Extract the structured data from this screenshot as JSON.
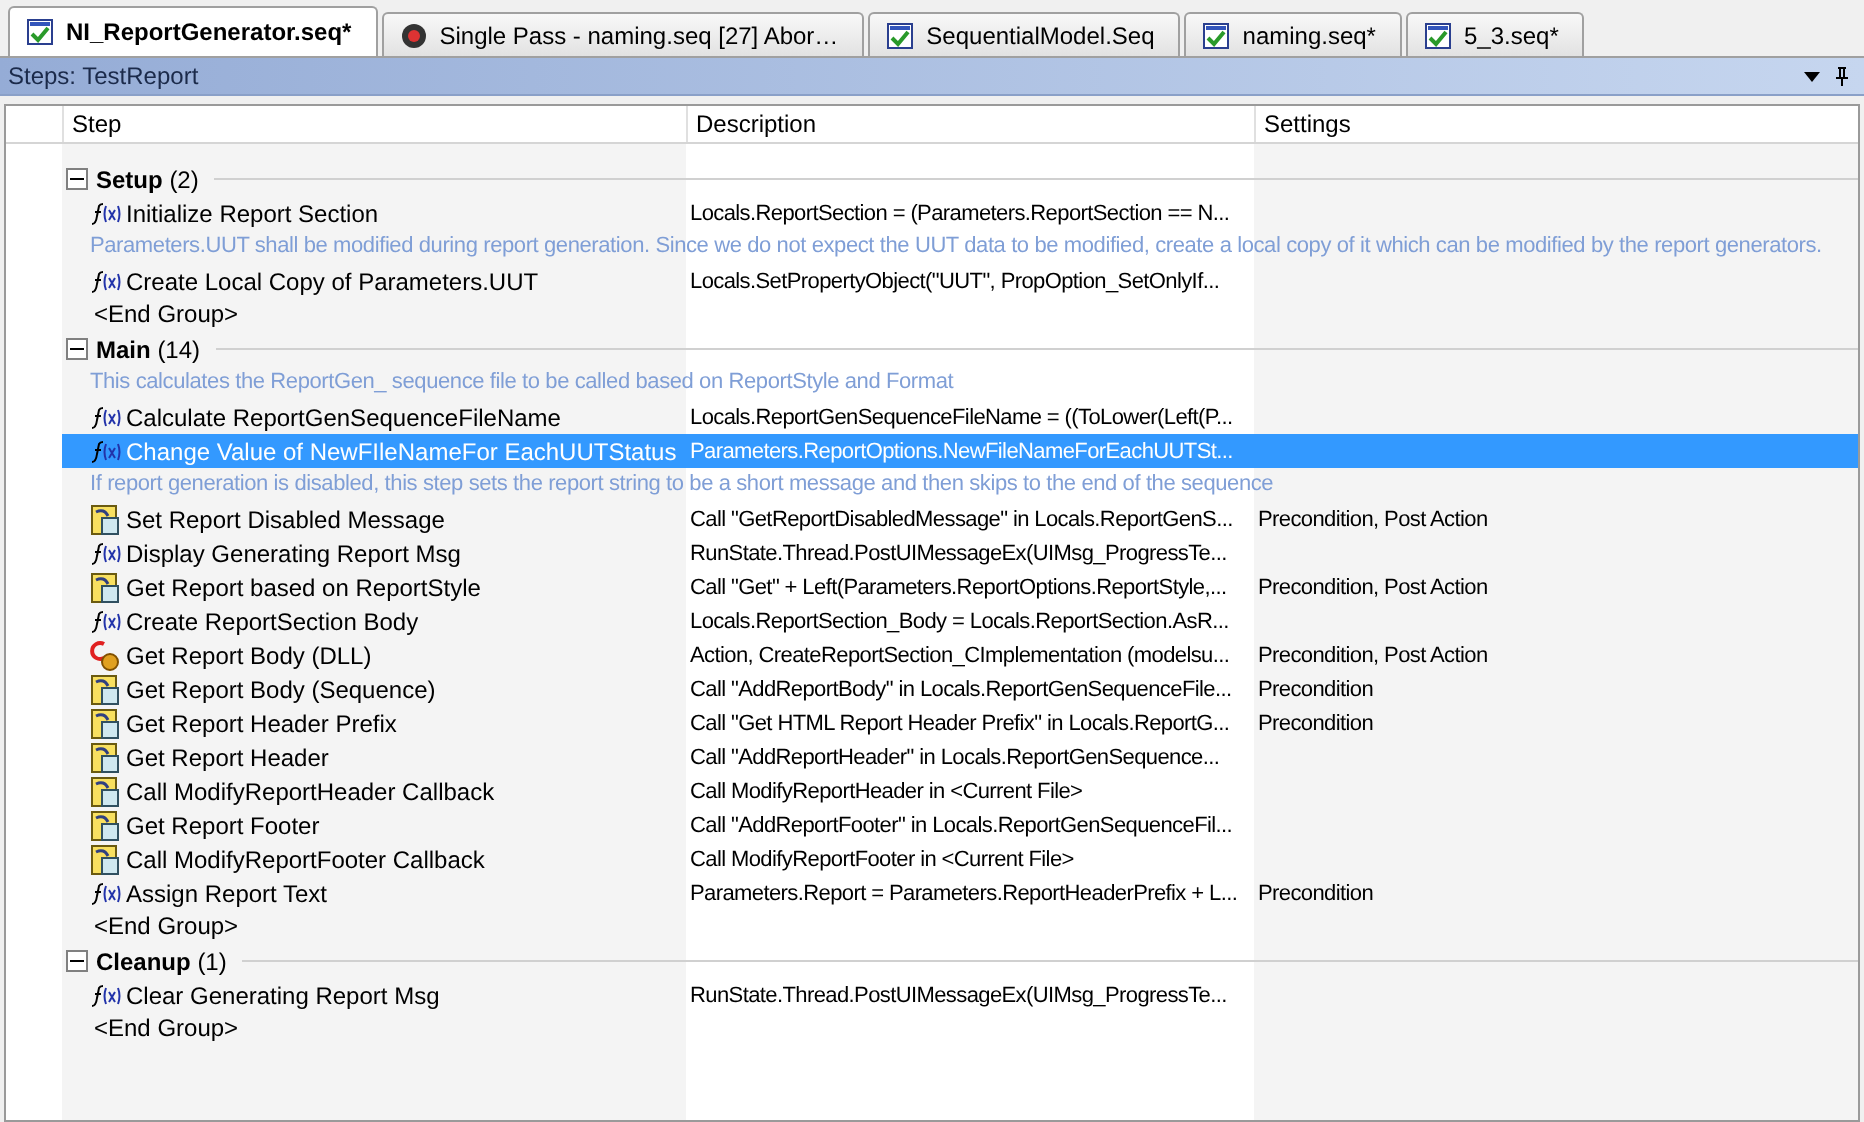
{
  "tabs": [
    {
      "label": "NI_ReportGenerator.seq*",
      "kind": "sequence",
      "selected": true
    },
    {
      "label": "Single Pass - naming.seq [27]  Abor…",
      "kind": "execution",
      "selected": false
    },
    {
      "label": "SequentialModel.Seq",
      "kind": "sequence",
      "selected": false
    },
    {
      "label": "naming.seq*",
      "kind": "sequence",
      "selected": false
    },
    {
      "label": "5_3.seq*",
      "kind": "sequence",
      "selected": false
    }
  ],
  "panel": {
    "title": "Steps: TestReport"
  },
  "columns": [
    "Step",
    "Description",
    "Settings"
  ],
  "groups": [
    {
      "name": "Setup",
      "count": "(2)",
      "expanded": true,
      "rows": [
        {
          "kind": "expression",
          "name": "Initialize Report Section",
          "description": "Locals.ReportSection = (Parameters.ReportSection == N...",
          "selected": false
        },
        {
          "kind": "comment",
          "text": "Parameters.UUT shall be modified during report generation. Since we do not expect the UUT data to be modified, create a local copy of it which can be modified by the report generators."
        },
        {
          "kind": "expression",
          "name": "Create Local Copy of Parameters.UUT",
          "description": "Locals.SetPropertyObject(\"UUT\", PropOption_SetOnlyIf...",
          "selected": false
        },
        {
          "kind": "end",
          "text": "<End Group>"
        }
      ]
    },
    {
      "name": "Main",
      "count": "(14)",
      "expanded": true,
      "rows": [
        {
          "kind": "comment",
          "text": "This calculates the ReportGen_ sequence file to be called based on ReportStyle and Format"
        },
        {
          "kind": "expression",
          "name": "Calculate ReportGenSequenceFileName",
          "description": "Locals.ReportGenSequenceFileName = ((ToLower(Left(P...",
          "selected": false
        },
        {
          "kind": "expression",
          "name": "Change Value of NewFIleNameFor EachUUTStatus",
          "description": "Parameters.ReportOptions.NewFileNameForEachUUTSt...",
          "selected": true
        },
        {
          "kind": "comment",
          "text": "If report generation is disabled, this step sets the report string to be a short message and then skips to the end of the sequence"
        },
        {
          "kind": "sequence-call",
          "name": "Set Report Disabled Message",
          "description": "Call \"GetReportDisabledMessage\" in Locals.ReportGenS...",
          "settings": "Precondition, Post Action",
          "selected": false
        },
        {
          "kind": "expression",
          "name": "Display Generating Report Msg",
          "description": "RunState.Thread.PostUIMessageEx(UIMsg_ProgressTe...",
          "selected": false
        },
        {
          "kind": "sequence-call",
          "name": "Get Report based on ReportStyle",
          "description": "Call \"Get\" + Left(Parameters.ReportOptions.ReportStyle,...",
          "settings": "Precondition, Post Action",
          "selected": false
        },
        {
          "kind": "expression",
          "name": "Create ReportSection Body",
          "description": "Locals.ReportSection_Body = Locals.ReportSection.AsR...",
          "selected": false
        },
        {
          "kind": "dll",
          "name": "Get Report Body (DLL)",
          "description": "Action,  CreateReportSection_CImplementation (modelsu...",
          "settings": "Precondition, Post Action",
          "selected": false
        },
        {
          "kind": "sequence-call",
          "name": "Get Report Body (Sequence)",
          "description": "Call \"AddReportBody\" in Locals.ReportGenSequenceFile...",
          "settings": "Precondition",
          "selected": false
        },
        {
          "kind": "sequence-call",
          "name": "Get Report Header Prefix",
          "description": "Call \"Get HTML Report Header Prefix\" in Locals.ReportG...",
          "settings": "Precondition",
          "selected": false
        },
        {
          "kind": "sequence-call",
          "name": "Get Report Header",
          "description": "Call \"AddReportHeader\" in Locals.ReportGenSequence...",
          "selected": false
        },
        {
          "kind": "sequence-call",
          "name": "Call ModifyReportHeader Callback",
          "description": "Call ModifyReportHeader in <Current File>",
          "selected": false
        },
        {
          "kind": "sequence-call",
          "name": "Get Report Footer",
          "description": "Call \"AddReportFooter\" in Locals.ReportGenSequenceFil...",
          "selected": false
        },
        {
          "kind": "sequence-call",
          "name": "Call ModifyReportFooter Callback",
          "description": "Call ModifyReportFooter in <Current File>",
          "selected": false
        },
        {
          "kind": "expression",
          "name": "Assign Report Text",
          "description": "Parameters.Report = Parameters.ReportHeaderPrefix + L...",
          "settings": "Precondition",
          "selected": false
        },
        {
          "kind": "end",
          "text": "<End Group>"
        }
      ]
    },
    {
      "name": "Cleanup",
      "count": "(1)",
      "expanded": true,
      "rows": [
        {
          "kind": "expression",
          "name": "Clear Generating Report Msg",
          "description": "RunState.Thread.PostUIMessageEx(UIMsg_ProgressTe...",
          "selected": false
        },
        {
          "kind": "end",
          "text": "<End Group>"
        }
      ]
    }
  ]
}
